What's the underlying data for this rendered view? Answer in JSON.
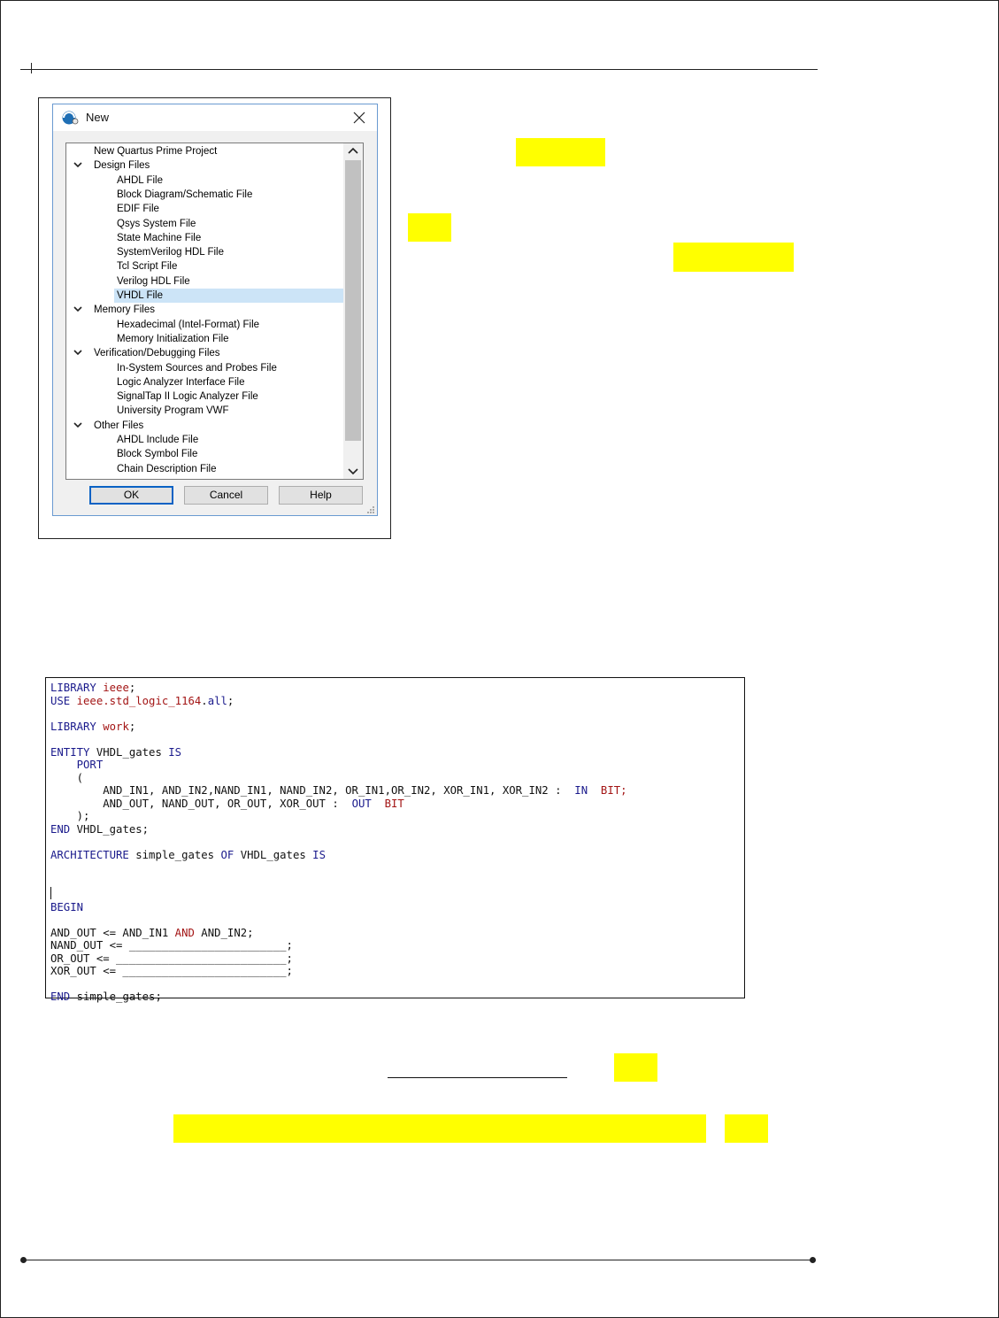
{
  "dialog": {
    "title": "New",
    "tree": [
      {
        "label": "New Quartus Prime Project",
        "level": 0,
        "expandable": false,
        "selected": false
      },
      {
        "label": "Design Files",
        "level": 0,
        "expandable": true,
        "selected": false
      },
      {
        "label": "AHDL File",
        "level": 1,
        "expandable": false,
        "selected": false
      },
      {
        "label": "Block Diagram/Schematic File",
        "level": 1,
        "expandable": false,
        "selected": false
      },
      {
        "label": "EDIF File",
        "level": 1,
        "expandable": false,
        "selected": false
      },
      {
        "label": "Qsys System File",
        "level": 1,
        "expandable": false,
        "selected": false
      },
      {
        "label": "State Machine File",
        "level": 1,
        "expandable": false,
        "selected": false
      },
      {
        "label": "SystemVerilog HDL File",
        "level": 1,
        "expandable": false,
        "selected": false
      },
      {
        "label": "Tcl Script File",
        "level": 1,
        "expandable": false,
        "selected": false
      },
      {
        "label": "Verilog HDL File",
        "level": 1,
        "expandable": false,
        "selected": false
      },
      {
        "label": "VHDL File",
        "level": 1,
        "expandable": false,
        "selected": true
      },
      {
        "label": "Memory Files",
        "level": 0,
        "expandable": true,
        "selected": false
      },
      {
        "label": "Hexadecimal (Intel-Format) File",
        "level": 1,
        "expandable": false,
        "selected": false
      },
      {
        "label": "Memory Initialization File",
        "level": 1,
        "expandable": false,
        "selected": false
      },
      {
        "label": "Verification/Debugging Files",
        "level": 0,
        "expandable": true,
        "selected": false
      },
      {
        "label": "In-System Sources and Probes File",
        "level": 1,
        "expandable": false,
        "selected": false
      },
      {
        "label": "Logic Analyzer Interface File",
        "level": 1,
        "expandable": false,
        "selected": false
      },
      {
        "label": "SignalTap II Logic Analyzer File",
        "level": 1,
        "expandable": false,
        "selected": false
      },
      {
        "label": "University Program VWF",
        "level": 1,
        "expandable": false,
        "selected": false
      },
      {
        "label": "Other Files",
        "level": 0,
        "expandable": true,
        "selected": false
      },
      {
        "label": "AHDL Include File",
        "level": 1,
        "expandable": false,
        "selected": false
      },
      {
        "label": "Block Symbol File",
        "level": 1,
        "expandable": false,
        "selected": false
      },
      {
        "label": "Chain Description File",
        "level": 1,
        "expandable": false,
        "selected": false
      }
    ],
    "buttons": {
      "ok": "OK",
      "cancel": "Cancel",
      "help": "Help"
    }
  },
  "code": {
    "l1_kw": "LIBRARY",
    "l1_lib": "ieee",
    "l1_end": ";",
    "l2_kw": "USE",
    "l2_lib": "ieee.std_logic_1164",
    "l2_dot": ".",
    "l2_all": "all",
    "l2_end": ";",
    "l4_kw": "LIBRARY",
    "l4_lib": "work",
    "l4_end": ";",
    "l6_kw": "ENTITY",
    "l6_name": "VHDL_gates",
    "l6_is": "IS",
    "l7_kw": "PORT",
    "l8": "(",
    "l9_ports": "AND_IN1, AND_IN2,NAND_IN1, NAND_IN2, OR_IN1,OR_IN2, XOR_IN1, XOR_IN2 :",
    "l9_dir": "IN",
    "l9_type": "BIT;",
    "l10_ports": "AND_OUT, NAND_OUT, OR_OUT, XOR_OUT :",
    "l10_dir": "OUT",
    "l10_type": "BIT",
    "l11": ");",
    "l12_kw": "END",
    "l12_rest": "VHDL_gates;",
    "l14_kw": "ARCHITECTURE",
    "l14_name": "simple_gates",
    "l14_of": "OF",
    "l14_ent": "VHDL_gates",
    "l14_is": "IS",
    "l17_kw": "BEGIN",
    "l19_lhs": "AND_OUT <= AND_IN1",
    "l19_op": "AND",
    "l19_rhs": "AND_IN2;",
    "l20": "NAND_OUT <= ________________________;",
    "l21": "OR_OUT <= __________________________;",
    "l22": "XOR_OUT <= _________________________;",
    "l24_kw": "END",
    "l24_rest": "simple_gates;"
  },
  "colors": {
    "highlight": "#ffff00",
    "keyword": "#1a1a8c",
    "library": "#a31515",
    "selection": "#cce4f7"
  }
}
